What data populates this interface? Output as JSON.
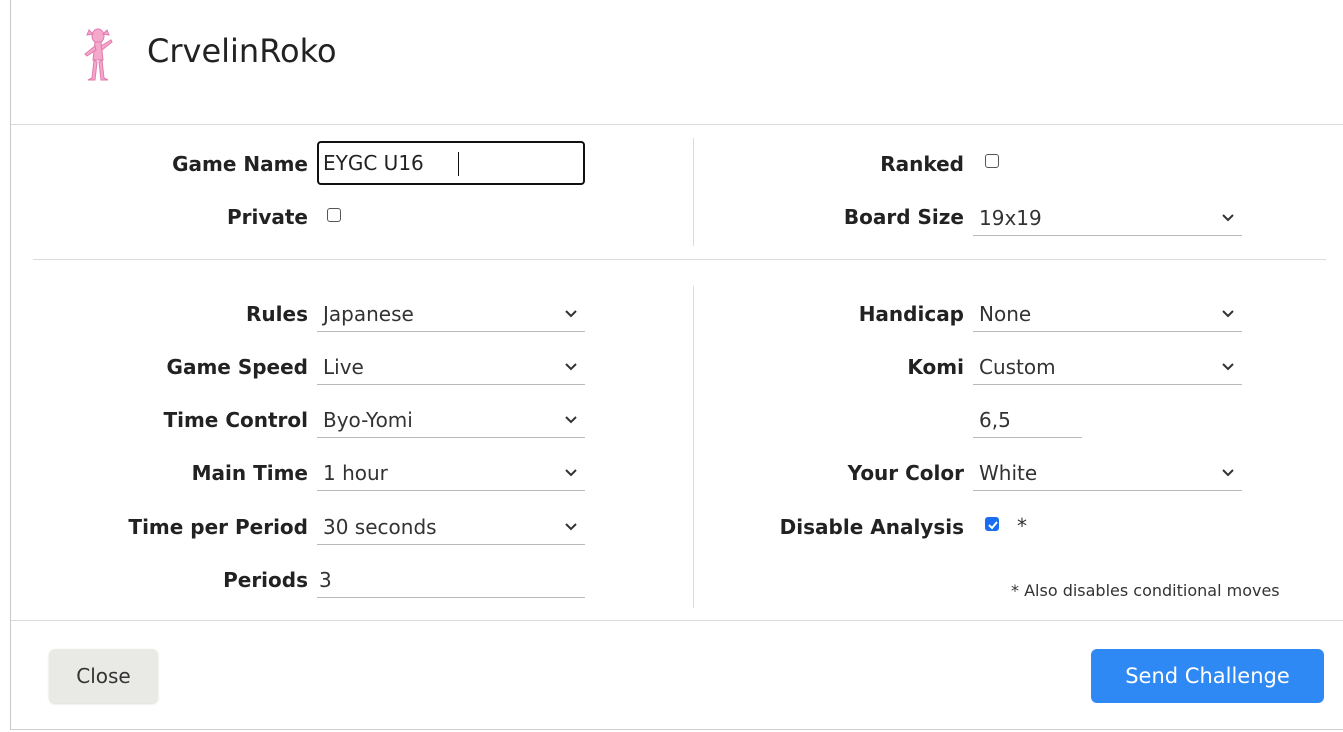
{
  "header": {
    "username": "CrvelinRoko",
    "avatar_icon": "pink-panther-avatar-icon"
  },
  "basic": {
    "game_name_label": "Game Name",
    "game_name_value": "EYGC U16",
    "private_label": "Private",
    "private_checked": false,
    "ranked_label": "Ranked",
    "ranked_checked": false,
    "board_size_label": "Board Size",
    "board_size_value": "19x19"
  },
  "settings": {
    "rules_label": "Rules",
    "rules_value": "Japanese",
    "game_speed_label": "Game Speed",
    "game_speed_value": "Live",
    "time_control_label": "Time Control",
    "time_control_value": "Byo-Yomi",
    "main_time_label": "Main Time",
    "main_time_value": "1 hour",
    "time_per_period_label": "Time per Period",
    "time_per_period_value": "30 seconds",
    "periods_label": "Periods",
    "periods_value": "3",
    "handicap_label": "Handicap",
    "handicap_value": "None",
    "komi_label": "Komi",
    "komi_value": "Custom",
    "komi_custom_value": "6,5",
    "your_color_label": "Your Color",
    "your_color_value": "White",
    "disable_analysis_label": "Disable Analysis",
    "disable_analysis_checked": true,
    "disable_analysis_asterisk": "*",
    "footnote": "* Also disables conditional moves"
  },
  "footer": {
    "close_label": "Close",
    "send_label": "Send Challenge"
  },
  "colors": {
    "accent": "#2f89f5",
    "close_bg": "#e9e9e5"
  }
}
